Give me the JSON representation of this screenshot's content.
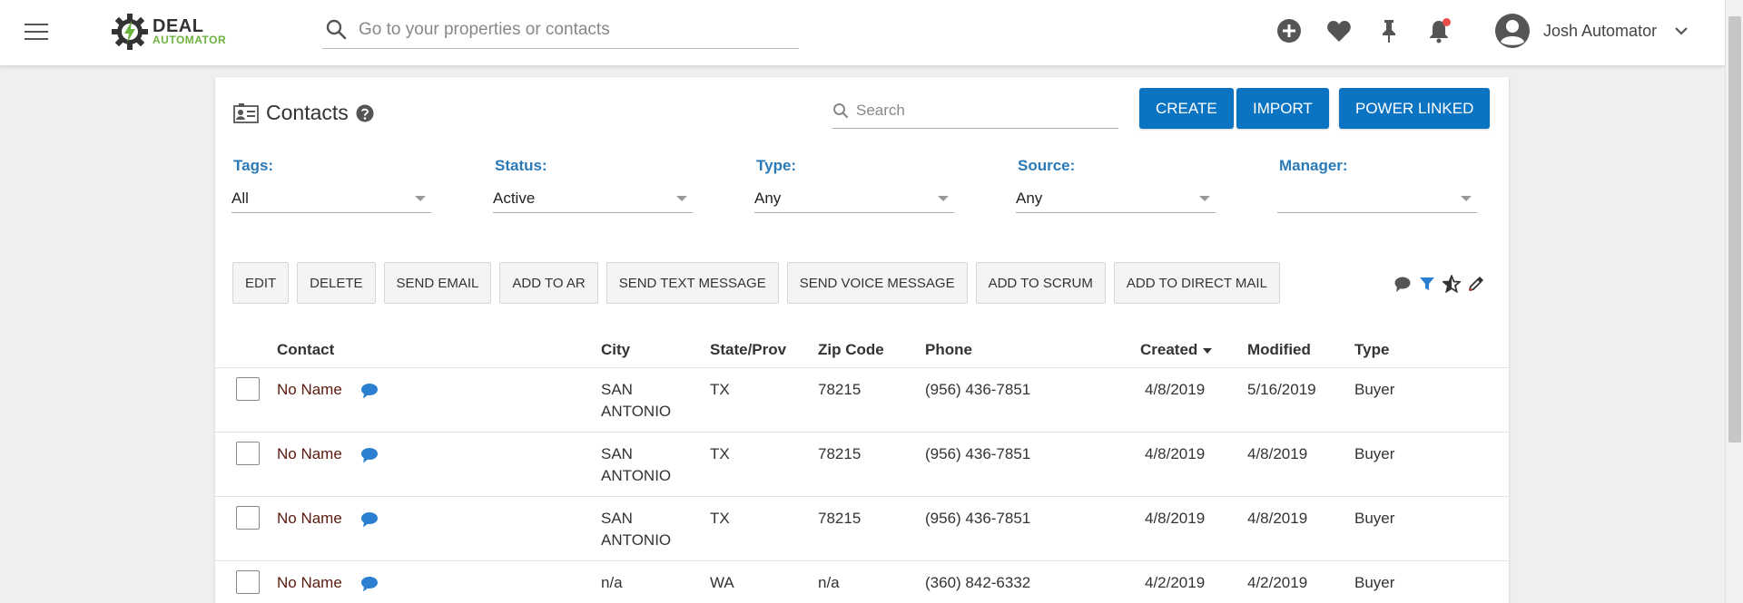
{
  "header": {
    "logo_top": "DEAL",
    "logo_bottom": "AUTOMATOR",
    "search_placeholder": "Go to your properties or contacts",
    "user_name": "Josh Automator"
  },
  "page": {
    "title": "Contacts",
    "search_placeholder": "Search",
    "buttons": {
      "create": "CREATE",
      "import": "IMPORT",
      "power_linked": "POWER LINKED"
    }
  },
  "filters": [
    {
      "label": "Tags:",
      "value": "All"
    },
    {
      "label": "Status:",
      "value": "Active"
    },
    {
      "label": "Type:",
      "value": "Any"
    },
    {
      "label": "Source:",
      "value": "Any"
    },
    {
      "label": "Manager:",
      "value": ""
    }
  ],
  "actions": [
    "EDIT",
    "DELETE",
    "SEND EMAIL",
    "ADD TO AR",
    "SEND TEXT MESSAGE",
    "SEND VOICE MESSAGE",
    "ADD TO SCRUM",
    "ADD TO DIRECT MAIL"
  ],
  "table": {
    "columns": {
      "contact": "Contact",
      "city": "City",
      "state": "State/Prov",
      "zip": "Zip Code",
      "phone": "Phone",
      "created": "Created",
      "modified": "Modified",
      "type": "Type"
    },
    "rows": [
      {
        "contact": "No Name",
        "city_1": "SAN",
        "city_2": "ANTONIO",
        "state": "TX",
        "zip": "78215",
        "phone": "(956) 436-7851",
        "created": "4/8/2019",
        "modified": "5/16/2019",
        "type": "Buyer"
      },
      {
        "contact": "No Name",
        "city_1": "SAN",
        "city_2": "ANTONIO",
        "state": "TX",
        "zip": "78215",
        "phone": "(956) 436-7851",
        "created": "4/8/2019",
        "modified": "4/8/2019",
        "type": "Buyer"
      },
      {
        "contact": "No Name",
        "city_1": "SAN",
        "city_2": "ANTONIO",
        "state": "TX",
        "zip": "78215",
        "phone": "(956) 436-7851",
        "created": "4/8/2019",
        "modified": "4/8/2019",
        "type": "Buyer"
      },
      {
        "contact": "No Name",
        "city_1": "n/a",
        "city_2": "",
        "state": "WA",
        "zip": "n/a",
        "phone": "(360) 842-6332",
        "created": "4/2/2019",
        "modified": "4/2/2019",
        "type": "Buyer"
      }
    ]
  },
  "colors": {
    "primary": "#0a73c2",
    "filter_label": "#2a7ab8",
    "chat_icon": "#2b7fd0",
    "notification": "#e94c4c",
    "logo_green": "#6db33f"
  }
}
